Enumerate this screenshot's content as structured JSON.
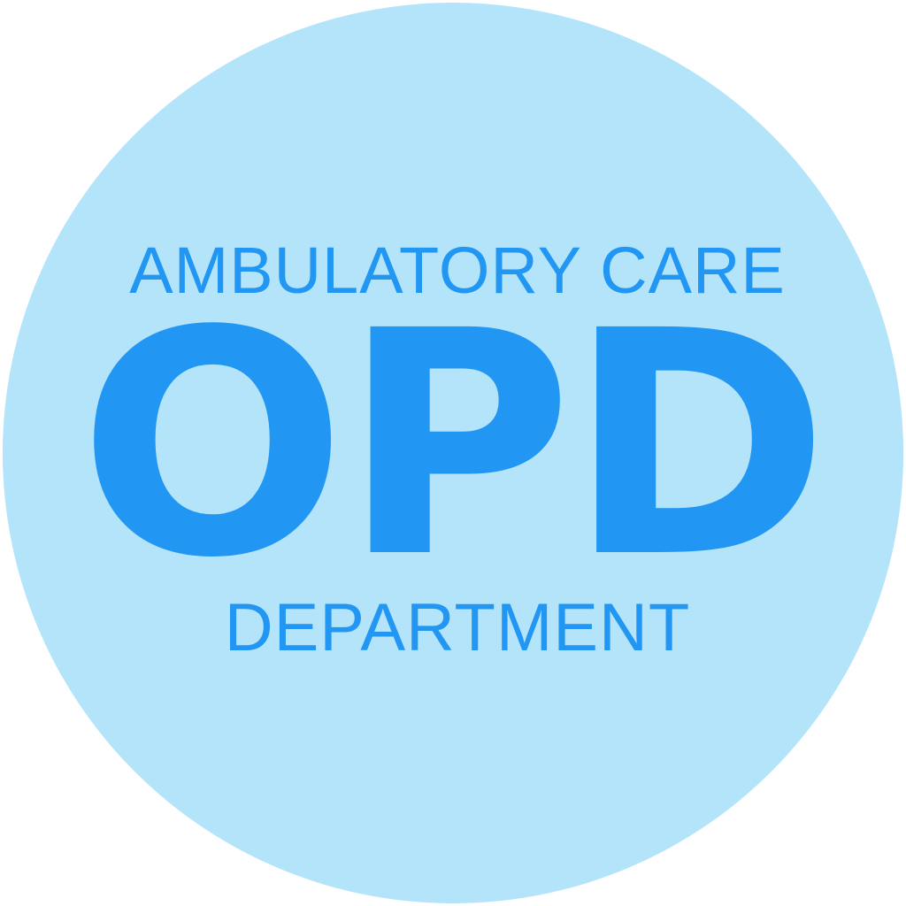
{
  "badge": {
    "top_text": "AMBULATORY CARE",
    "main_text": "OPD",
    "bottom_text": "DEPARTMENT",
    "colors": {
      "circle": "#b3e4fa",
      "text": "#2196f3",
      "background": "#ffffff"
    }
  }
}
